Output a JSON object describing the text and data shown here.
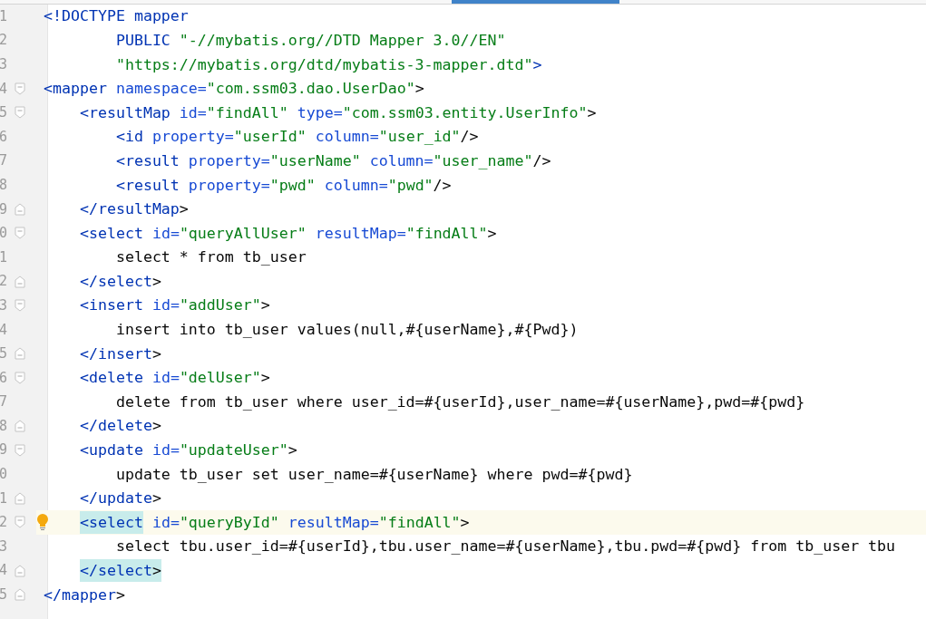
{
  "editor": {
    "lines": [
      {
        "n": "1",
        "fold_start": false,
        "fold_end": false,
        "current": false,
        "tokens": [
          {
            "kind": "tag",
            "t": "<!DOCTYPE mapper"
          }
        ]
      },
      {
        "n": "2",
        "fold_start": false,
        "fold_end": false,
        "current": false,
        "tokens": [
          {
            "kind": "tag",
            "t": "        PUBLIC "
          },
          {
            "kind": "str",
            "t": "\"-//mybatis.org//DTD Mapper 3.0//EN\""
          }
        ]
      },
      {
        "n": "3",
        "fold_start": false,
        "fold_end": false,
        "current": false,
        "tokens": [
          {
            "kind": "str",
            "t": "        \"https://mybatis.org/dtd/mybatis-3-mapper.dtd\""
          },
          {
            "kind": "tag",
            "t": ">"
          }
        ]
      },
      {
        "n": "4",
        "fold_start": true,
        "fold_end": false,
        "current": false,
        "tokens": [
          {
            "kind": "tag",
            "t": "<mapper"
          },
          {
            "kind": "attr",
            "t": " namespace="
          },
          {
            "kind": "str",
            "t": "\"com.ssm03.dao.UserDao\""
          },
          {
            "kind": "plain",
            "t": ">"
          }
        ]
      },
      {
        "n": "5",
        "fold_start": true,
        "fold_end": false,
        "current": false,
        "tokens": [
          {
            "kind": "tag",
            "t": "    <resultMap"
          },
          {
            "kind": "attr",
            "t": " id="
          },
          {
            "kind": "str",
            "t": "\"findAll\""
          },
          {
            "kind": "attr",
            "t": " type="
          },
          {
            "kind": "str",
            "t": "\"com.ssm03.entity.UserInfo\""
          },
          {
            "kind": "plain",
            "t": ">"
          }
        ]
      },
      {
        "n": "6",
        "fold_start": false,
        "fold_end": false,
        "current": false,
        "tokens": [
          {
            "kind": "tag",
            "t": "        <id"
          },
          {
            "kind": "attr",
            "t": " property="
          },
          {
            "kind": "str",
            "t": "\"userId\""
          },
          {
            "kind": "attr",
            "t": " column="
          },
          {
            "kind": "str",
            "t": "\"user_id\""
          },
          {
            "kind": "plain",
            "t": "/>"
          }
        ]
      },
      {
        "n": "7",
        "fold_start": false,
        "fold_end": false,
        "current": false,
        "tokens": [
          {
            "kind": "tag",
            "t": "        <result"
          },
          {
            "kind": "attr",
            "t": " property="
          },
          {
            "kind": "str",
            "t": "\"userName\""
          },
          {
            "kind": "attr",
            "t": " column="
          },
          {
            "kind": "str",
            "t": "\"user_name\""
          },
          {
            "kind": "plain",
            "t": "/>"
          }
        ]
      },
      {
        "n": "8",
        "fold_start": false,
        "fold_end": false,
        "current": false,
        "tokens": [
          {
            "kind": "tag",
            "t": "        <result"
          },
          {
            "kind": "attr",
            "t": " property="
          },
          {
            "kind": "str",
            "t": "\"pwd\""
          },
          {
            "kind": "attr",
            "t": " column="
          },
          {
            "kind": "str",
            "t": "\"pwd\""
          },
          {
            "kind": "plain",
            "t": "/>"
          }
        ]
      },
      {
        "n": "9",
        "fold_start": false,
        "fold_end": true,
        "current": false,
        "tokens": [
          {
            "kind": "tag",
            "t": "    </resultMap"
          },
          {
            "kind": "plain",
            "t": ">"
          }
        ]
      },
      {
        "n": "0",
        "fold_start": true,
        "fold_end": false,
        "current": false,
        "tokens": [
          {
            "kind": "tag",
            "t": "    <select"
          },
          {
            "kind": "attr",
            "t": " id="
          },
          {
            "kind": "str",
            "t": "\"queryAllUser\""
          },
          {
            "kind": "attr",
            "t": " resultMap="
          },
          {
            "kind": "str",
            "t": "\"findAll\""
          },
          {
            "kind": "plain",
            "t": ">"
          }
        ]
      },
      {
        "n": "1",
        "fold_start": false,
        "fold_end": false,
        "current": false,
        "tokens": [
          {
            "kind": "plain",
            "t": "        select * from tb_user"
          }
        ]
      },
      {
        "n": "2",
        "fold_start": false,
        "fold_end": true,
        "current": false,
        "tokens": [
          {
            "kind": "tag",
            "t": "    </select"
          },
          {
            "kind": "plain",
            "t": ">"
          }
        ]
      },
      {
        "n": "3",
        "fold_start": true,
        "fold_end": false,
        "current": false,
        "tokens": [
          {
            "kind": "tag",
            "t": "    <insert"
          },
          {
            "kind": "attr",
            "t": " id="
          },
          {
            "kind": "str",
            "t": "\"addUser\""
          },
          {
            "kind": "plain",
            "t": ">"
          }
        ]
      },
      {
        "n": "4",
        "fold_start": false,
        "fold_end": false,
        "current": false,
        "tokens": [
          {
            "kind": "plain",
            "t": "        insert into tb_user values(null,#{userName},#{Pwd})"
          }
        ]
      },
      {
        "n": "5",
        "fold_start": false,
        "fold_end": true,
        "current": false,
        "tokens": [
          {
            "kind": "tag",
            "t": "    </insert"
          },
          {
            "kind": "plain",
            "t": ">"
          }
        ]
      },
      {
        "n": "6",
        "fold_start": true,
        "fold_end": false,
        "current": false,
        "tokens": [
          {
            "kind": "tag",
            "t": "    <delete"
          },
          {
            "kind": "attr",
            "t": " id="
          },
          {
            "kind": "str",
            "t": "\"delUser\""
          },
          {
            "kind": "plain",
            "t": ">"
          }
        ]
      },
      {
        "n": "7",
        "fold_start": false,
        "fold_end": false,
        "current": false,
        "tokens": [
          {
            "kind": "plain",
            "t": "        delete from tb_user where user_id=#{userId},user_name=#{userName},pwd=#{pwd}"
          }
        ]
      },
      {
        "n": "8",
        "fold_start": false,
        "fold_end": true,
        "current": false,
        "tokens": [
          {
            "kind": "tag",
            "t": "    </delete"
          },
          {
            "kind": "plain",
            "t": ">"
          }
        ]
      },
      {
        "n": "9",
        "fold_start": true,
        "fold_end": false,
        "current": false,
        "tokens": [
          {
            "kind": "tag",
            "t": "    <update"
          },
          {
            "kind": "attr",
            "t": " id="
          },
          {
            "kind": "str",
            "t": "\"updateUser\""
          },
          {
            "kind": "plain",
            "t": ">"
          }
        ]
      },
      {
        "n": "0",
        "fold_start": false,
        "fold_end": false,
        "current": false,
        "tokens": [
          {
            "kind": "plain",
            "t": "        update tb_user set user_name=#{userName} where pwd=#{pwd}"
          }
        ]
      },
      {
        "n": "1",
        "fold_start": false,
        "fold_end": true,
        "current": false,
        "tokens": [
          {
            "kind": "tag",
            "t": "    </update"
          },
          {
            "kind": "plain",
            "t": ">"
          }
        ]
      },
      {
        "n": "2",
        "fold_start": true,
        "fold_end": false,
        "current": true,
        "tokens": [
          {
            "kind": "tag",
            "t": "    <select",
            "match": true
          },
          {
            "kind": "attr",
            "t": " id="
          },
          {
            "kind": "str",
            "t": "\"queryById\""
          },
          {
            "kind": "attr",
            "t": " resultMap="
          },
          {
            "kind": "str",
            "t": "\"findAll\""
          },
          {
            "kind": "plain",
            "t": ">"
          }
        ]
      },
      {
        "n": "3",
        "fold_start": false,
        "fold_end": false,
        "current": false,
        "tokens": [
          {
            "kind": "plain",
            "t": "        select tbu.user_id=#{userId},tbu.user_name=#{userName},tbu.pwd=#{pwd} from tb_user tbu"
          }
        ]
      },
      {
        "n": "4",
        "fold_start": false,
        "fold_end": true,
        "current": false,
        "tokens": [
          {
            "kind": "tag",
            "t": "    </select",
            "match": true
          },
          {
            "kind": "plain",
            "t": ">",
            "match": true
          }
        ]
      },
      {
        "n": "5",
        "fold_start": false,
        "fold_end": true,
        "current": false,
        "tokens": [
          {
            "kind": "tag",
            "t": "</mapper"
          },
          {
            "kind": "plain",
            "t": ">"
          }
        ]
      }
    ]
  }
}
